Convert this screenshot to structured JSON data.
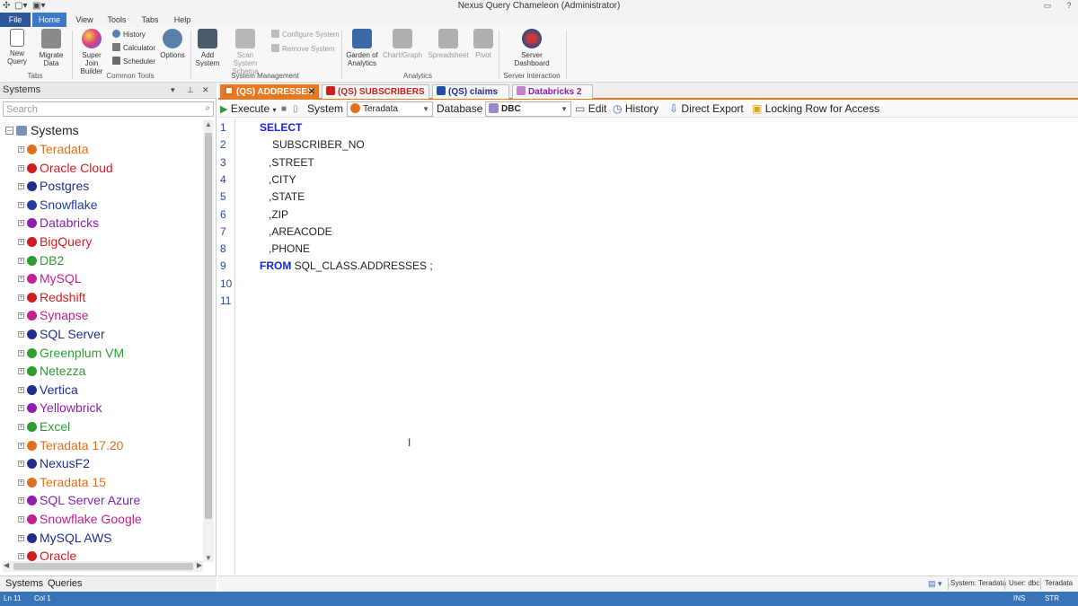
{
  "window": {
    "title": "Nexus Query Chameleon (Administrator)"
  },
  "menu": {
    "tabs": [
      "File",
      "Home",
      "View",
      "Tools",
      "Tabs",
      "Help"
    ],
    "active": "Home"
  },
  "ribbon": {
    "new_query": "New Query",
    "migrate_data": "Migrate Data",
    "tabs_group": "Tabs",
    "super_join": "Super Join Builder",
    "history": "History",
    "calculator": "Calculator",
    "scheduler": "Scheduler",
    "options": "Options",
    "common_tools_group": "Common Tools",
    "add_system": "Add System",
    "scan_system_schema": "Scan System Schema",
    "configure_system": "Configure System",
    "remove_system": "Remove System",
    "system_management_group": "System Management",
    "garden": "Garden of Analytics",
    "chart_graph": "Chart/Graph",
    "spreadsheet": "Spreadsheet",
    "pivot": "Pivot",
    "analytics_group": "Analytics",
    "server_dashboard": "Server Dashboard",
    "server_interaction_group": "Server Interaction"
  },
  "left_panel": {
    "title": "Systems",
    "search_placeholder": "Search",
    "root": "Systems",
    "items": [
      {
        "label": "Teradata",
        "color": "#e0701f",
        "icon": "teradata-icon"
      },
      {
        "label": "Oracle Cloud",
        "color": "#cc1f1f",
        "icon": "oracle-icon"
      },
      {
        "label": "Postgres",
        "color": "#1f2f8f",
        "icon": "postgres-icon"
      },
      {
        "label": "Snowflake",
        "color": "#1f3fa0",
        "icon": "snowflake-icon"
      },
      {
        "label": "Databricks",
        "color": "#8a1fb0",
        "icon": "databricks-icon"
      },
      {
        "label": "BigQuery",
        "color": "#cc1f1f",
        "icon": "bigquery-icon"
      },
      {
        "label": "DB2",
        "color": "#2f9a2f",
        "icon": "db2-icon"
      },
      {
        "label": "MySQL",
        "color": "#c0218f",
        "icon": "mysql-icon"
      },
      {
        "label": "Redshift",
        "color": "#cc1f1f",
        "icon": "redshift-icon"
      },
      {
        "label": "Synapse",
        "color": "#c0218f",
        "icon": "synapse-icon"
      },
      {
        "label": "SQL Server",
        "color": "#1f2f8f",
        "icon": "sqlserver-icon"
      },
      {
        "label": "Greenplum VM",
        "color": "#2fa02f",
        "icon": "greenplum-icon"
      },
      {
        "label": "Netezza",
        "color": "#2f9a2f",
        "icon": "netezza-icon"
      },
      {
        "label": "Vertica",
        "color": "#1f2f8f",
        "icon": "vertica-icon"
      },
      {
        "label": "Yellowbrick",
        "color": "#8a1fb0",
        "icon": "yellowbrick-icon"
      },
      {
        "label": "Excel",
        "color": "#2f9a2f",
        "icon": "excel-icon"
      },
      {
        "label": "Teradata 17.20",
        "color": "#e0701f",
        "icon": "teradata-icon"
      },
      {
        "label": "NexusF2",
        "color": "#1f2f8f",
        "icon": "nexus-icon"
      },
      {
        "label": "Teradata 15",
        "color": "#e0701f",
        "icon": "teradata-icon"
      },
      {
        "label": "SQL Server Azure",
        "color": "#8a1fb0",
        "icon": "sqlserver-icon"
      },
      {
        "label": "Snowflake Google",
        "color": "#c0218f",
        "icon": "snowflake-icon"
      },
      {
        "label": "MySQL AWS",
        "color": "#1f2f8f",
        "icon": "mysql-icon"
      },
      {
        "label": "Oracle",
        "color": "#cc1f1f",
        "icon": "oracle-icon"
      }
    ],
    "bottom_tabs": [
      "Systems",
      "Queries"
    ]
  },
  "doc_tabs": [
    {
      "label": "(QS) ADDRESSES",
      "color": "#ffffff",
      "icon_color": "#e0701f",
      "active": true
    },
    {
      "label": "(QS) SUBSCRIBERS",
      "color": "#cc1f1f",
      "icon_color": "#cc1f1f",
      "active": false
    },
    {
      "label": "(QS) claims",
      "color": "#1f2f8f",
      "icon_color": "#1f4f9f",
      "active": false
    },
    {
      "label": "Databricks 2",
      "color": "#8a1fb0",
      "icon_color": "#c080d0",
      "active": false
    }
  ],
  "editor_toolbar": {
    "execute": "Execute",
    "system_label": "System",
    "system_value": "Teradata",
    "database_label": "Database",
    "database_value": "DBC",
    "edit": "Edit",
    "history": "History",
    "direct_export": "Direct Export",
    "locking_row": "Locking Row for Access"
  },
  "code": {
    "lines": [
      {
        "n": "1",
        "indent": 26,
        "kw": "SELECT",
        "text": ""
      },
      {
        "n": "2",
        "indent": 40,
        "kw": "",
        "text": "SUBSCRIBER_NO"
      },
      {
        "n": "3",
        "indent": 36,
        "kw": "",
        "text": ",STREET"
      },
      {
        "n": "4",
        "indent": 36,
        "kw": "",
        "text": ",CITY"
      },
      {
        "n": "5",
        "indent": 36,
        "kw": "",
        "text": ",STATE"
      },
      {
        "n": "6",
        "indent": 36,
        "kw": "",
        "text": ",ZIP"
      },
      {
        "n": "7",
        "indent": 36,
        "kw": "",
        "text": ",AREACODE"
      },
      {
        "n": "8",
        "indent": 36,
        "kw": "",
        "text": ",PHONE"
      },
      {
        "n": "9",
        "indent": 26,
        "kw": "FROM",
        "text": " SQL_CLASS.ADDRESSES ;"
      },
      {
        "n": "10",
        "indent": 0,
        "kw": "",
        "text": ""
      },
      {
        "n": "11",
        "indent": 0,
        "kw": "",
        "text": ""
      }
    ]
  },
  "editor_status": {
    "system": "System: Teradata",
    "user": "User: dbc",
    "db": "Teradata"
  },
  "statusbar": {
    "ln": "Ln 11",
    "col": "Col 1",
    "ins": "INS",
    "str": "STR"
  }
}
